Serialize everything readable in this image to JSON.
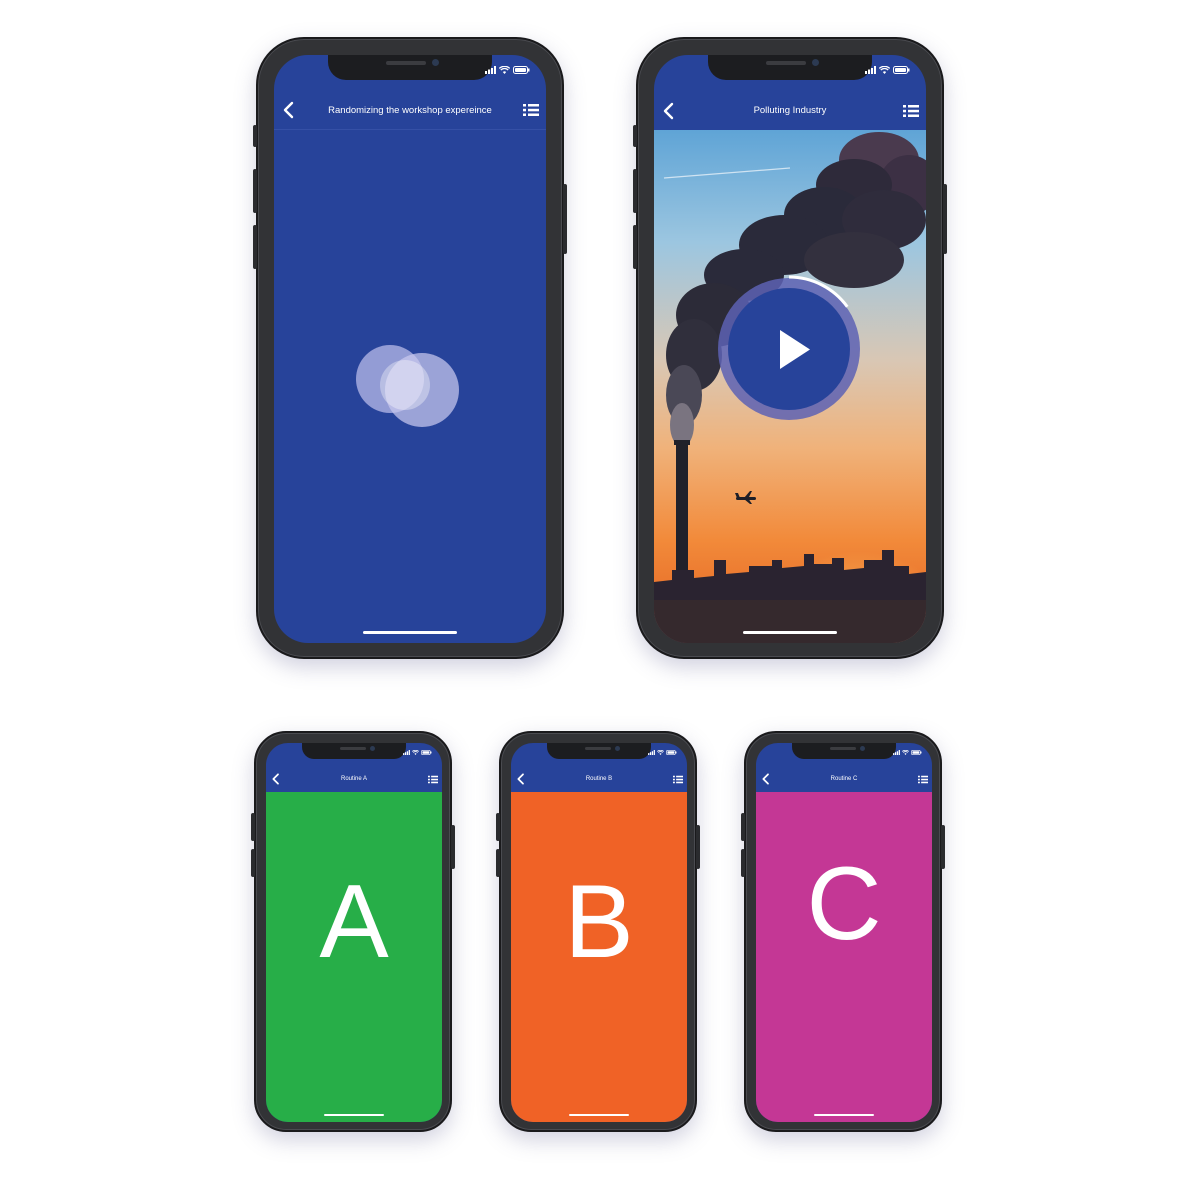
{
  "phones": {
    "randomizing": {
      "title": "Randomizing the workshop expereince",
      "back_icon": "chevron-left-icon",
      "menu_icon": "list-icon",
      "background_color": "#27439a",
      "loader_icon": "overlapping-circles-icon"
    },
    "polluting": {
      "title": "Polluting Industry",
      "back_icon": "chevron-left-icon",
      "menu_icon": "list-icon",
      "media_icon": "play-icon",
      "progress": 0.15
    },
    "routine_a": {
      "title": "Routine A",
      "letter": "A",
      "background_color": "#27ae48"
    },
    "routine_b": {
      "title": "Routine B",
      "letter": "B",
      "background_color": "#f06226"
    },
    "routine_c": {
      "title": "Routine C",
      "letter": "C",
      "background_color": "#c43795"
    }
  }
}
